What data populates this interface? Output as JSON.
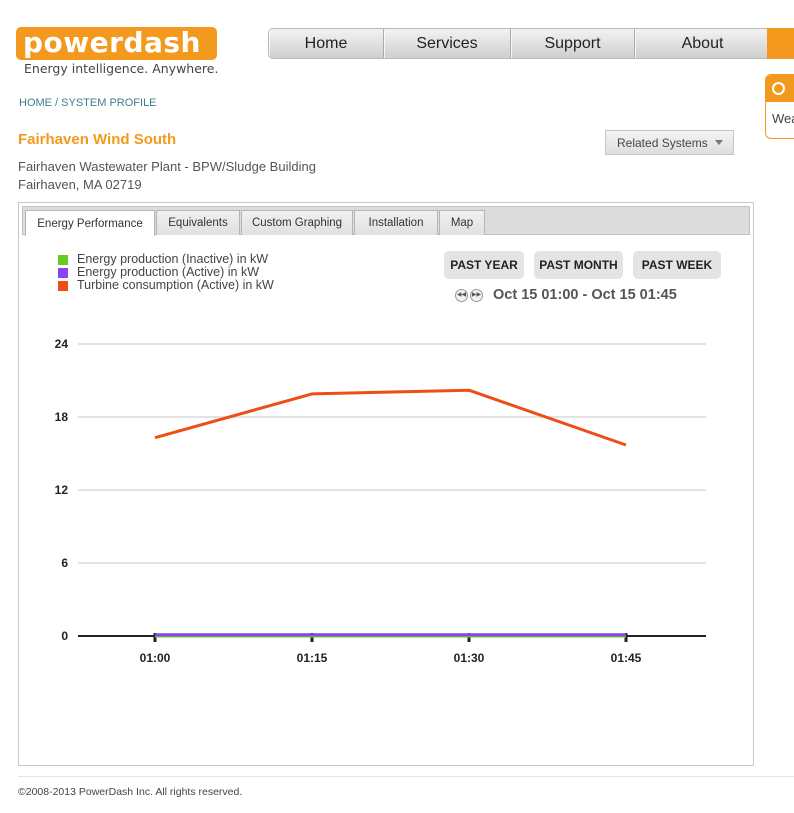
{
  "header": {
    "logo_text": "powerdash",
    "tagline": "Energy intelligence. Anywhere.",
    "nav": [
      {
        "label": "Home"
      },
      {
        "label": "Services"
      },
      {
        "label": "Support"
      },
      {
        "label": "About"
      }
    ]
  },
  "side_panel": {
    "text": "Wea"
  },
  "breadcrumb": "HOME / SYSTEM PROFILE",
  "system": {
    "title": "Fairhaven Wind South",
    "address_line1": "Fairhaven Wastewater Plant - BPW/Sludge Building",
    "address_line2": "Fairhaven, MA 02719",
    "related_label": "Related Systems"
  },
  "tabs": [
    {
      "label": "Energy Performance",
      "active": true
    },
    {
      "label": "Equivalents",
      "active": false
    },
    {
      "label": "Custom Graphing",
      "active": false
    },
    {
      "label": "Installation",
      "active": false
    },
    {
      "label": "Map",
      "active": false
    }
  ],
  "range_buttons": [
    {
      "label": "PAST YEAR"
    },
    {
      "label": "PAST MONTH"
    },
    {
      "label": "PAST WEEK"
    }
  ],
  "date_range": "Oct 15 01:00 - Oct 15 01:45",
  "chart_data": {
    "type": "line",
    "title": "",
    "xlabel": "",
    "ylabel": "",
    "categories": [
      "01:00",
      "01:15",
      "01:30",
      "01:45"
    ],
    "ylim": [
      0,
      24
    ],
    "yticks": [
      0,
      6,
      12,
      18,
      24
    ],
    "grid": true,
    "legend_position": "top-left",
    "series": [
      {
        "name": "Energy production (Inactive) in kW",
        "color": "#66cc22",
        "values": [
          0,
          0,
          0,
          0
        ]
      },
      {
        "name": "Energy production (Active) in kW",
        "color": "#8844ee",
        "values": [
          0.1,
          0.1,
          0.1,
          0.1
        ]
      },
      {
        "name": "Turbine consumption (Active) in kW",
        "color": "#ee4e14",
        "values": [
          16.3,
          19.9,
          20.2,
          15.7
        ]
      }
    ]
  },
  "footer": "©2008-2013 PowerDash Inc. All rights reserved."
}
